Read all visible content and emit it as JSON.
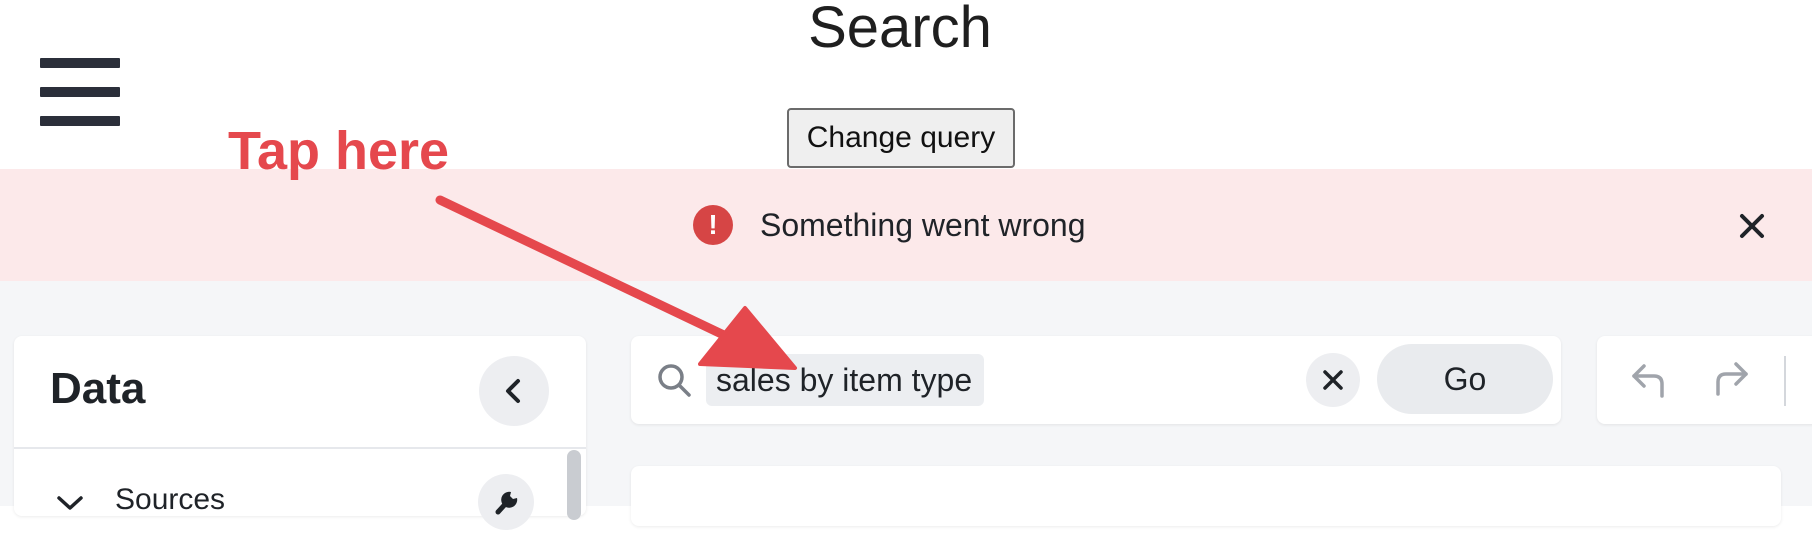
{
  "header": {
    "title": "Search",
    "change_query_label": "Change query",
    "menu_icon": "hamburger-menu-icon"
  },
  "error_banner": {
    "message": "Something went wrong",
    "icon": "exclamation-circle-icon",
    "close_icon": "close-icon",
    "background": "#fce9ea",
    "icon_color": "#d64545"
  },
  "data_panel": {
    "title": "Data",
    "collapse_icon": "chevron-left-icon",
    "sources_label": "Sources",
    "sources_icon": "chevron-down-icon",
    "settings_icon": "wrench-icon"
  },
  "search": {
    "icon": "search-icon",
    "query": "sales by item type",
    "clear_icon": "close-icon",
    "go_label": "Go"
  },
  "history": {
    "undo_icon": "undo-icon",
    "redo_icon": "redo-icon"
  },
  "annotation": {
    "text": "Tap here",
    "color": "#e5484d"
  }
}
